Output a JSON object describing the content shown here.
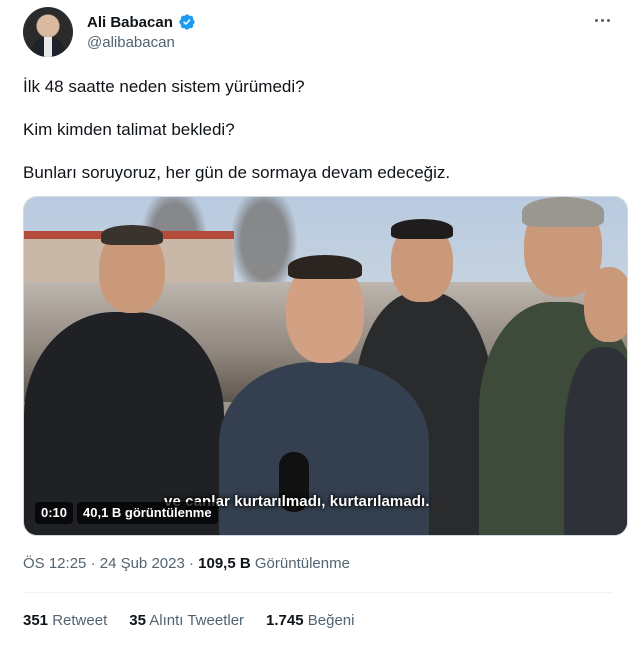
{
  "author": {
    "display_name": "Ali Babacan",
    "handle": "@alibabacan",
    "verified_icon": "verified-badge-icon",
    "accent_color": "#1d9bf0"
  },
  "tweet": {
    "lines": [
      "İlk 48 saatte neden sistem yürümedi?",
      "Kim kimden talimat bekledi?",
      "Bunları soruyoruz, her gün de sormaya devam edeceğiz."
    ]
  },
  "video": {
    "subtitle": "ve canlar kurtarılmadı, kurtarılamadı.",
    "elapsed": "0:10",
    "views_label": "40,1 B görüntülenme"
  },
  "meta": {
    "time": "ÖS 12:25",
    "separator": "·",
    "date": "24 Şub 2023",
    "views_count": "109,5 B",
    "views_label": "Görüntülenme"
  },
  "stats": {
    "retweets_count": "351",
    "retweets_label": "Retweet",
    "quotes_count": "35",
    "quotes_label": "Alıntı Tweetler",
    "likes_count": "1.745",
    "likes_label": "Beğeni"
  }
}
